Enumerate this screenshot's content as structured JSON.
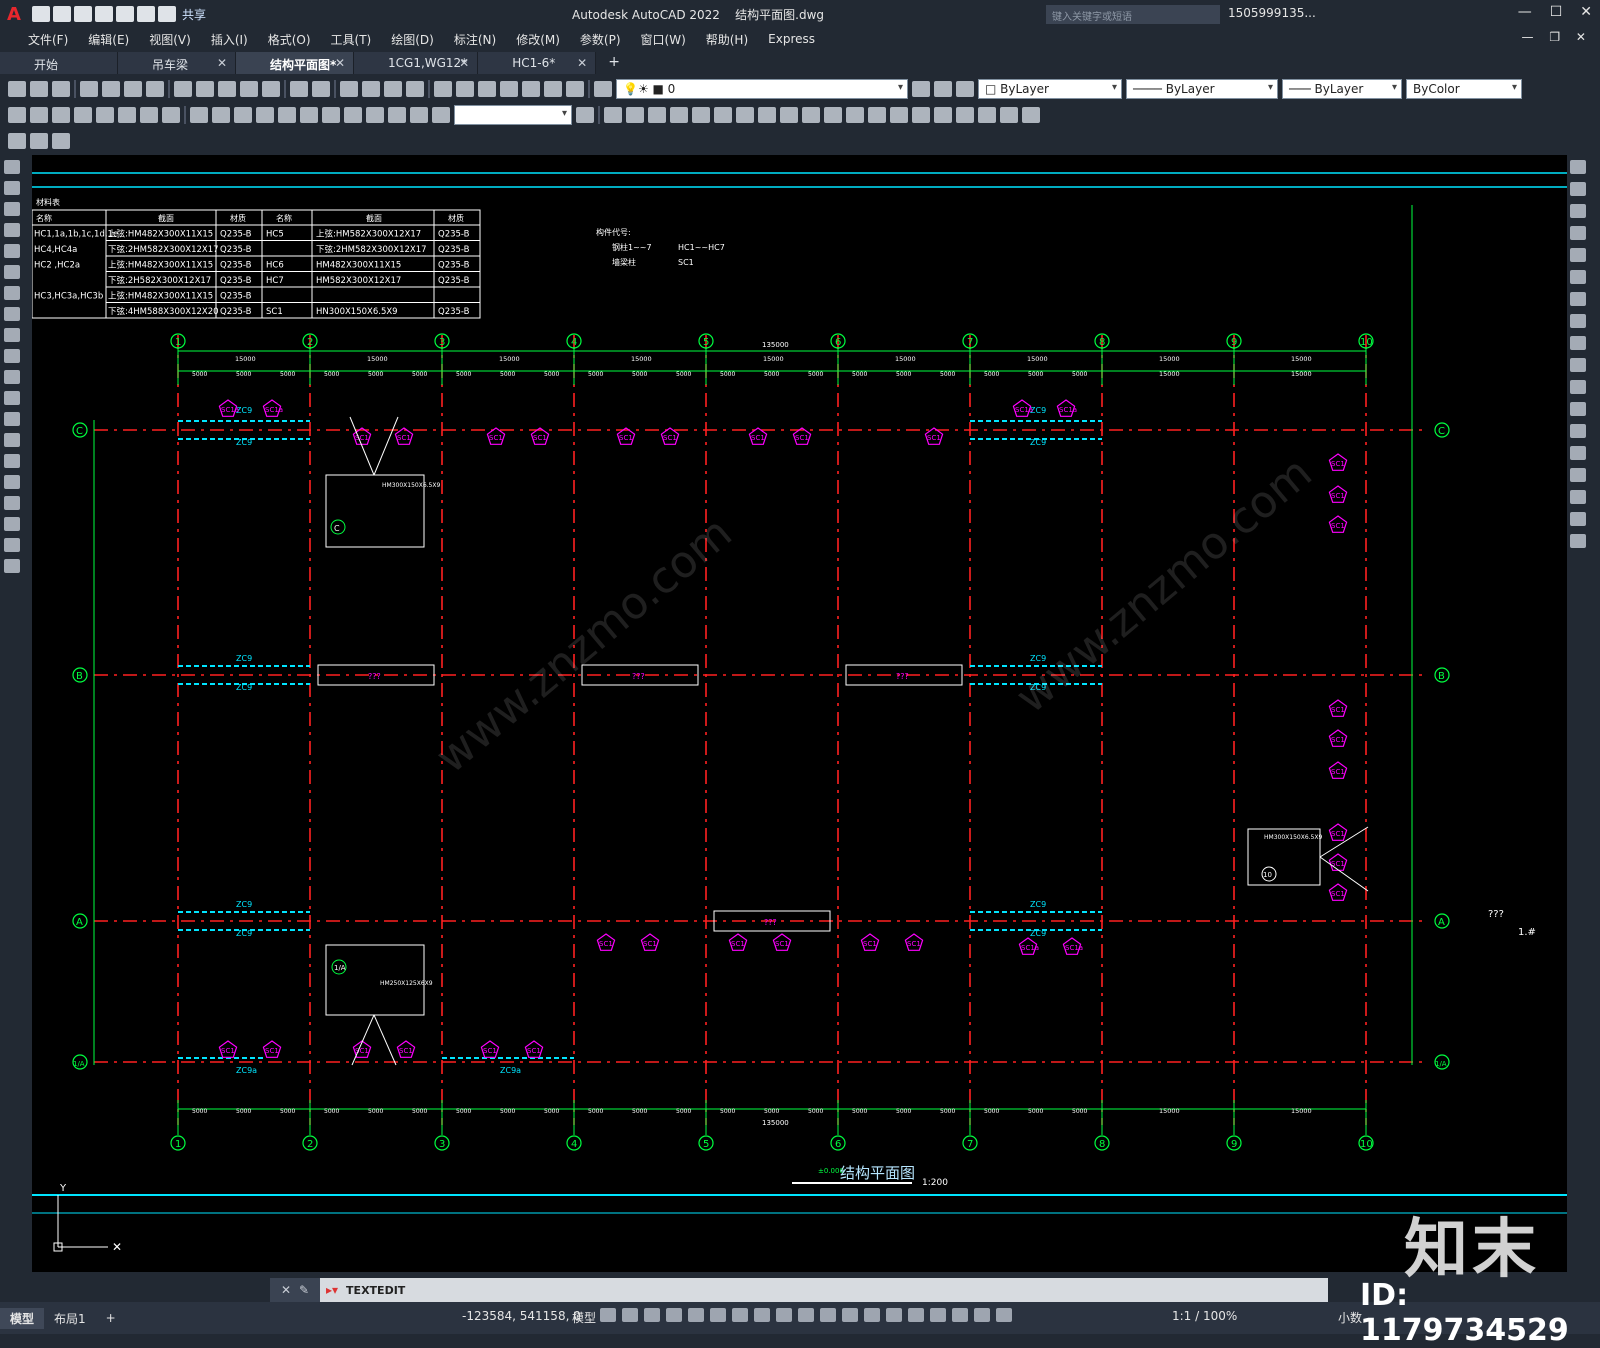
{
  "app": {
    "title": "Autodesk AutoCAD 2022    结构平面图.dwg",
    "share": "共享",
    "search_placeholder": "键入关键字或短语",
    "user": "1505999135...",
    "menus": [
      "文件(F)",
      "编辑(E)",
      "视图(V)",
      "插入(I)",
      "格式(O)",
      "工具(T)",
      "绘图(D)",
      "标注(N)",
      "修改(M)",
      "参数(P)",
      "窗口(W)",
      "帮助(H)",
      "Express"
    ]
  },
  "tabs": [
    {
      "label": "开始",
      "active": false,
      "closable": false
    },
    {
      "label": "吊车梁",
      "active": false,
      "closable": true
    },
    {
      "label": "结构平面图*",
      "active": true,
      "closable": true
    },
    {
      "label": "1CG1,WG12*",
      "active": false,
      "closable": true
    },
    {
      "label": "HC1-6*",
      "active": false,
      "closable": true
    }
  ],
  "layer_bar": {
    "layer": "0",
    "color": "ByLayer",
    "linetype": "ByLayer",
    "lineweight": "ByLayer",
    "plotstyle": "ByColor"
  },
  "material_table": {
    "title": "材料表",
    "headers": [
      "名称",
      "截面",
      "材质",
      "名称",
      "截面",
      "材质"
    ],
    "rows": [
      [
        "HC1,1a,1b,1c,1d,1e",
        "上弦:HM482X300X11X15",
        "Q235-B",
        "HC5",
        "上弦:HM582X300X12X17",
        "Q235-B"
      ],
      [
        "HC4,HC4a",
        "下弦:2HM582X300X12X17",
        "Q235-B",
        "",
        "下弦:2HM582X300X12X17",
        "Q235-B"
      ],
      [
        "HC2 ,HC2a",
        "上弦:HM482X300X11X15",
        "Q235-B",
        "HC6",
        "HM482X300X11X15",
        "Q235-B"
      ],
      [
        "",
        "下弦:2H582X300X12X17",
        "Q235-B",
        "HC7",
        "HM582X300X12X17",
        "Q235-B"
      ],
      [
        "HC3,HC3a,HC3b",
        "上弦:HM482X300X11X15",
        "Q235-B",
        "",
        "",
        ""
      ],
      [
        "",
        "下弦:4HM588X300X12X20",
        "Q235-B",
        "SC1",
        "HN300X150X6.5X9",
        "Q235-B"
      ]
    ]
  },
  "legend_note": {
    "title": "构件代号:",
    "rows": [
      [
        "钢柱1~~7",
        "HC1~~HC7"
      ],
      [
        "墙梁柱",
        "SC1"
      ]
    ]
  },
  "axes": {
    "numbers": [
      "1",
      "2",
      "3",
      "4",
      "5",
      "6",
      "7",
      "8",
      "9",
      "10"
    ],
    "letters": [
      "C",
      "B",
      "A",
      "1/A"
    ],
    "top_total": "135000",
    "bottom_total": "135000",
    "bay": "15000",
    "sub": "5000"
  },
  "drawing": {
    "title": "结构平面图",
    "scale": "1:200",
    "elev": "±0.000",
    "unknown": "???",
    "side_label": "1.#",
    "section_c": "HM300X150X6.5X9",
    "section_10": "HM300X150X6.5X9",
    "section_1a": "HM250X125X6X9"
  },
  "tags": {
    "sc": "SC1",
    "sc1a": "SC1a",
    "zc9": "ZC9",
    "zc9a": "ZC9a"
  },
  "command": {
    "text": "TEXTEDIT"
  },
  "status": {
    "model_tab": "模型",
    "layout_tab": "布局1",
    "coords": "-123584, 541158, 0",
    "model_label": "模型",
    "scale": "1:1 / 100%",
    "units": "小数"
  },
  "watermark": {
    "logo": "知末",
    "id": "ID: 1179734529",
    "site": "www.znzmo.com"
  },
  "colors": {
    "grid": "#ff2020",
    "green": "#00ff40",
    "cyan": "#00e5ff",
    "magenta": "#ff00ff",
    "white": "#ffffff"
  }
}
